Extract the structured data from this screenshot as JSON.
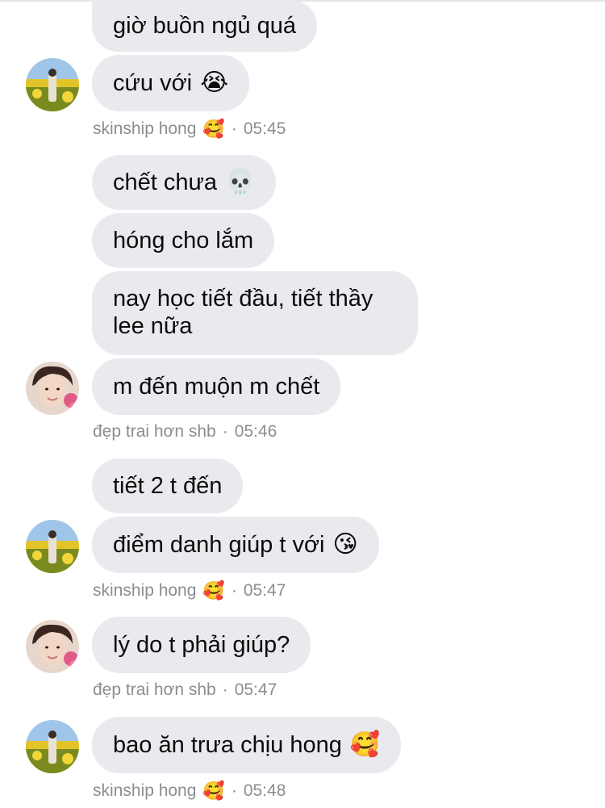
{
  "messages": [
    {
      "text": "giờ buồn ngủ quá",
      "emoji": ""
    },
    {
      "text": "cứu với",
      "emoji": "😭"
    },
    {
      "text": "chết chưa",
      "emoji": "💀"
    },
    {
      "text": "hóng cho lắm",
      "emoji": ""
    },
    {
      "text": "nay học tiết đầu, tiết thầy lee nữa",
      "emoji": ""
    },
    {
      "text": "m đến muộn m chết",
      "emoji": ""
    },
    {
      "text": "tiết 2 t đến",
      "emoji": ""
    },
    {
      "text": "điểm danh giúp t với",
      "emoji": "😘"
    },
    {
      "text": "lý do t phải giúp?",
      "emoji": ""
    },
    {
      "text": "bao ăn trưa chịu hong",
      "emoji": "🥰"
    }
  ],
  "meta": [
    {
      "sender": "skinship hong",
      "emoji": "🥰",
      "sep": "·",
      "time": "05:45"
    },
    {
      "sender": "đẹp trai hơn shb",
      "emoji": "",
      "sep": "·",
      "time": "05:46"
    },
    {
      "sender": "skinship hong",
      "emoji": "🥰",
      "sep": "·",
      "time": "05:47"
    },
    {
      "sender": "đẹp trai hơn shb",
      "emoji": "",
      "sep": "·",
      "time": "05:47"
    },
    {
      "sender": "skinship hong",
      "emoji": "🥰",
      "sep": "·",
      "time": "05:48"
    }
  ],
  "colors": {
    "bubble": "#e9eaee",
    "meta_text": "#8a8d91",
    "text": "#0b0b0b"
  }
}
